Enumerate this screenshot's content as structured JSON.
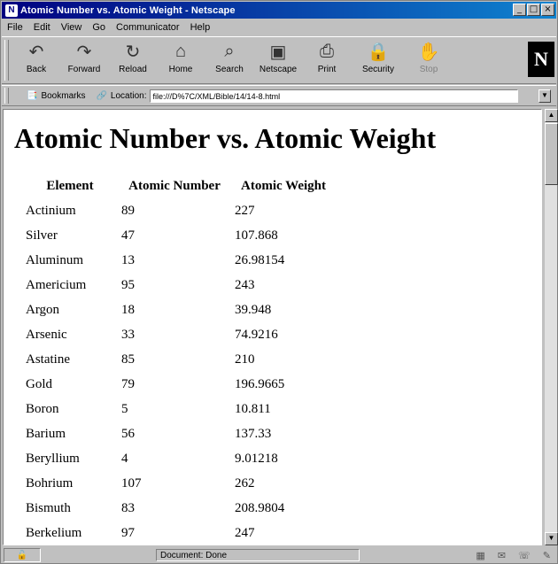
{
  "window": {
    "title": "Atomic Number vs. Atomic Weight - Netscape",
    "controls": [
      "_",
      "□",
      "×"
    ]
  },
  "menu": [
    "File",
    "Edit",
    "View",
    "Go",
    "Communicator",
    "Help"
  ],
  "toolbar": [
    {
      "label": "Back",
      "icon": "back-arrow-icon",
      "glyph": "↶"
    },
    {
      "label": "Forward",
      "icon": "forward-arrow-icon",
      "glyph": "↷"
    },
    {
      "label": "Reload",
      "icon": "reload-icon",
      "glyph": "↻"
    },
    {
      "label": "Home",
      "icon": "home-icon",
      "glyph": "⌂"
    },
    {
      "label": "Search",
      "icon": "search-icon",
      "glyph": "⌕"
    },
    {
      "label": "Netscape",
      "icon": "netscape-icon",
      "glyph": "▣"
    },
    {
      "label": "Print",
      "icon": "print-icon",
      "glyph": "⎙"
    },
    {
      "label": "Security",
      "icon": "security-icon",
      "glyph": "🔒"
    },
    {
      "label": "Stop",
      "icon": "stop-icon",
      "glyph": "✋",
      "disabled": true
    }
  ],
  "logo": "N",
  "location_bar": {
    "bookmarks_label": "Bookmarks",
    "location_label": "Location:",
    "url": "file:///D%7C/XML/Bible/14/14-8.html"
  },
  "page": {
    "title": "Atomic Number vs. Atomic Weight",
    "headers": [
      "Element",
      "Atomic Number",
      "Atomic Weight"
    ],
    "rows": [
      [
        "Actinium",
        "89",
        "227"
      ],
      [
        "Silver",
        "47",
        "107.868"
      ],
      [
        "Aluminum",
        "13",
        "26.98154"
      ],
      [
        "Americium",
        "95",
        "243"
      ],
      [
        "Argon",
        "18",
        "39.948"
      ],
      [
        "Arsenic",
        "33",
        "74.9216"
      ],
      [
        "Astatine",
        "85",
        "210"
      ],
      [
        "Gold",
        "79",
        "196.9665"
      ],
      [
        "Boron",
        "5",
        "10.811"
      ],
      [
        "Barium",
        "56",
        "137.33"
      ],
      [
        "Beryllium",
        "4",
        "9.01218"
      ],
      [
        "Bohrium",
        "107",
        "262"
      ],
      [
        "Bismuth",
        "83",
        "208.9804"
      ],
      [
        "Berkelium",
        "97",
        "247"
      ]
    ]
  },
  "status": {
    "text": "Document: Done"
  }
}
